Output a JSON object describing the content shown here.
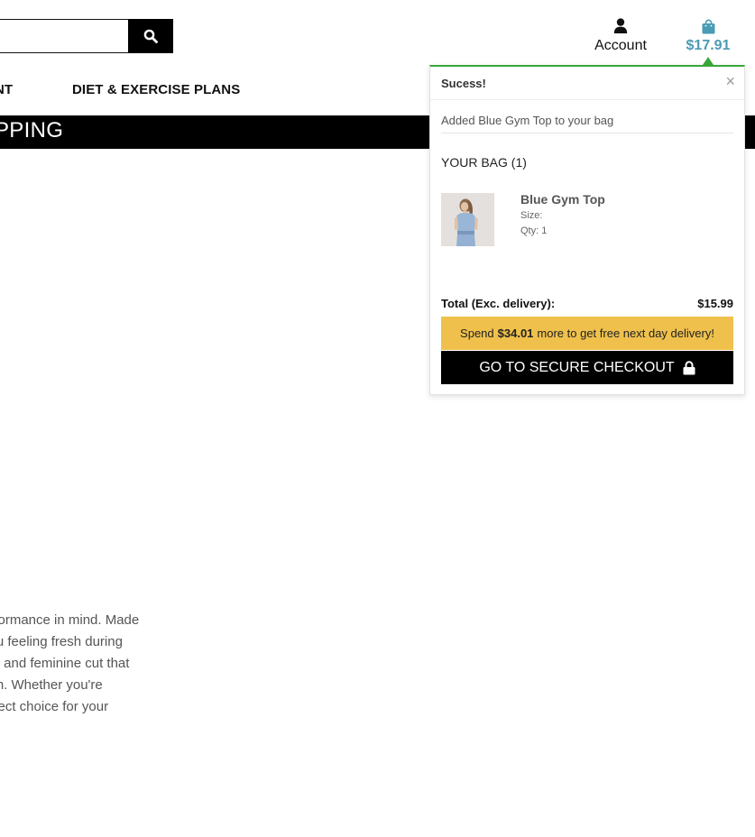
{
  "header": {
    "account_label": "Account",
    "bag_total": "$17.91",
    "accent_color": "#4a9bb5"
  },
  "nav": {
    "items": [
      {
        "label": "NT"
      },
      {
        "label": "DIET & EXERCISE PLANS"
      }
    ]
  },
  "banner": {
    "text": "PPING"
  },
  "product": {
    "description_lines": [
      "erformance in mind. Made",
      "you feeling fresh during",
      "ing and feminine cut that",
      "tion. Whether you're",
      "erfect choice for your"
    ]
  },
  "popover": {
    "title": "Sucess!",
    "close_glyph": "×",
    "message": "Added Blue Gym Top to your bag",
    "bag_heading": "YOUR BAG (1)",
    "item": {
      "name": "Blue Gym Top",
      "size_label": "Size:",
      "qty_label": "Qty: 1"
    },
    "total_label": "Total (Exc. delivery):",
    "total_value": "$15.99",
    "delivery": {
      "prefix": "Spend",
      "amount": "$34.01",
      "suffix": "more to get free next day delivery!"
    },
    "checkout_label": "GO TO SECURE CHECKOUT",
    "success_color": "#3aa73a",
    "delivery_color": "#efc14c"
  },
  "icons": {
    "search": "search-icon",
    "account": "user-icon",
    "bag": "shopping-bag-icon",
    "lock": "lock-icon"
  }
}
